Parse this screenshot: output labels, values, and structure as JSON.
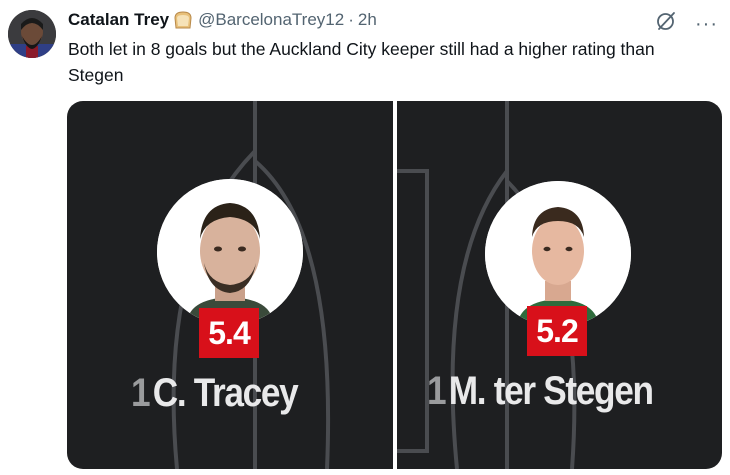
{
  "tweet": {
    "author_name": "Catalan Trey",
    "author_handle": "@BarcelonaTrey12",
    "separator": "·",
    "timestamp": "2h",
    "text": "Both let in 8 goals but the Auckland City keeper still had a higher rating than Stegen",
    "more_label": "···"
  },
  "media": {
    "left_player": {
      "number": "1",
      "name": "C. Tracey",
      "rating": "5.4"
    },
    "right_player": {
      "number": "1",
      "name": "M. ter Stegen",
      "rating": "5.2"
    }
  },
  "colors": {
    "rating_bg": "#d8101a",
    "panel_bg": "#1e1f21",
    "text_primary": "#0f1419",
    "text_secondary": "#536471"
  },
  "icons": [
    "avatar",
    "bread-emoji-icon",
    "grok-icon",
    "more-icon"
  ]
}
